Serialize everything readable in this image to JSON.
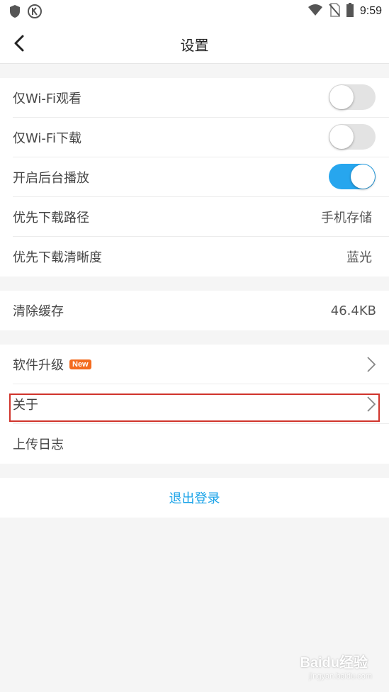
{
  "status_bar": {
    "left_icons": [
      "shield-icon",
      "k-circle-icon"
    ],
    "right_icons": [
      "wifi-icon",
      "no-sim-icon",
      "battery-icon"
    ],
    "time": "9:59"
  },
  "nav": {
    "title": "设置",
    "back_icon": "chevron-left-icon"
  },
  "group1": [
    {
      "label": "仅Wi-Fi观看",
      "toggle": false
    },
    {
      "label": "仅Wi-Fi下载",
      "toggle": false
    },
    {
      "label": "开启后台播放",
      "toggle": true
    },
    {
      "label": "优先下载路径",
      "value": "手机存储"
    },
    {
      "label": "优先下载清晰度",
      "value": "蓝光"
    }
  ],
  "group2": {
    "label": "清除缓存",
    "value": "46.4KB"
  },
  "group3": {
    "upgrade_label": "软件升级",
    "upgrade_badge": "New",
    "about_label": "关于",
    "upload_log_label": "上传日志"
  },
  "logout_label": "退出登录",
  "colors": {
    "accent": "#27a6ee",
    "badge": "#f36b1f",
    "highlight": "#d0342c",
    "logout_text": "#1aa3e8"
  },
  "watermark": {
    "text": "Baidu经验",
    "sub": "jingyan.baidu.com"
  }
}
